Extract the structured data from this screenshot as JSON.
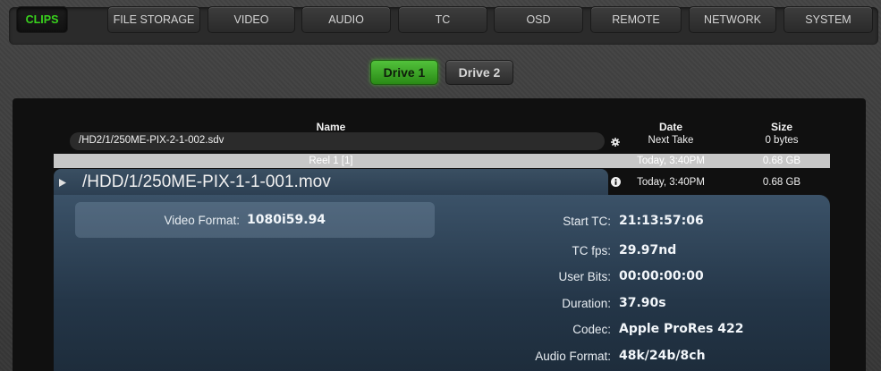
{
  "tabs": [
    {
      "label": "CLIPS",
      "active": true
    },
    {
      "label": "FILE STORAGE",
      "active": false
    },
    {
      "label": "VIDEO",
      "active": false
    },
    {
      "label": "AUDIO",
      "active": false
    },
    {
      "label": "TC",
      "active": false
    },
    {
      "label": "OSD",
      "active": false
    },
    {
      "label": "REMOTE",
      "active": false
    },
    {
      "label": "NETWORK",
      "active": false
    },
    {
      "label": "SYSTEM",
      "active": false
    }
  ],
  "drives": {
    "drive1": "Drive 1",
    "drive2": "Drive 2",
    "selected": "Drive 1"
  },
  "columns": {
    "name": "Name",
    "date": "Date",
    "size": "Size"
  },
  "next_take": {
    "name": "/HD2/1/250ME-PIX-2-1-002.sdv",
    "icon": "gear-icon",
    "date": "Next Take",
    "size": "0 bytes"
  },
  "reel": {
    "label": "Reel 1 [1]",
    "date": "Today, 3:40PM",
    "size": "0.68 GB"
  },
  "selected_clip": {
    "name": "/HDD/1/250ME-PIX-1-1-001.mov",
    "icon": "info-icon",
    "date": "Today, 3:40PM",
    "size": "0.68 GB"
  },
  "details": {
    "video_format_label": "Video Format:",
    "video_format": "1080i59.94",
    "start_tc_label": "Start TC:",
    "start_tc": "21:13:57:06",
    "tc_fps_label": "TC fps:",
    "tc_fps": "29.97nd",
    "user_bits_label": "User Bits:",
    "user_bits": "00:00:00:00",
    "duration_label": "Duration:",
    "duration": "37.90s",
    "codec_label": "Codec:",
    "codec": "Apple ProRes 422",
    "audio_format_label": "Audio Format:",
    "audio_format": "48k/24b/8ch"
  },
  "colors": {
    "active_tab": "#39d31d",
    "drive_selected": "#3aa722",
    "detail_panel": "#2c4256"
  }
}
